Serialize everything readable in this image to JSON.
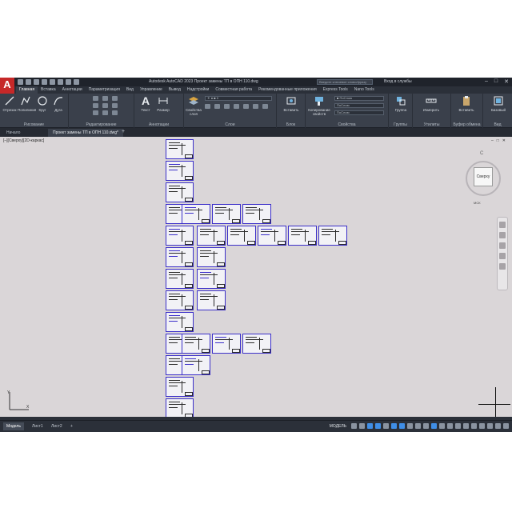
{
  "window": {
    "title": "Autodesk AutoCAD 2023   Проект замены ТП в ОПН 110.dwg",
    "search_placeholder": "Введите ключевое слово/фразу",
    "user": "Вход в службы",
    "controls": [
      "–",
      "□",
      "✕"
    ]
  },
  "ribbon_tabs": [
    "Главная",
    "Вставка",
    "Аннотации",
    "Параметризация",
    "Вид",
    "Управление",
    "Вывод",
    "Надстройки",
    "Совместная работа",
    "Рекомендованные приложения",
    "Express Tools",
    "Nano Tools"
  ],
  "ribbon": {
    "draw": {
      "title": "Рисование",
      "tools": [
        "Отрезок",
        "Полилиния",
        "Круг",
        "Дуга"
      ]
    },
    "modify": {
      "title": "Редактирование"
    },
    "annotation": {
      "title": "Аннотации",
      "tools": [
        "Текст",
        "Размер"
      ]
    },
    "layers": {
      "title": "Слои",
      "tools": [
        "Свойства слоя"
      ]
    },
    "block": {
      "title": "Блок",
      "tools": [
        "Вставить"
      ]
    },
    "properties": {
      "title": "Свойства",
      "tools": [
        "Копирование свойств"
      ],
      "linetype": "ПоСлою",
      "lineweight": "ПоСлою"
    },
    "groups": {
      "title": "Группы",
      "tools": [
        "Группа"
      ]
    },
    "utilities": {
      "title": "Утилиты",
      "tools": [
        "Измерить"
      ]
    },
    "clipboard": {
      "title": "Буфер обмена",
      "tools": [
        "Вставить"
      ]
    },
    "view": {
      "title": "Вид",
      "tools": [
        "Базовый"
      ]
    }
  },
  "file_tabs": {
    "start": "Начало",
    "active": "Проект замены ТП в ОПН 110.dwg*",
    "add": "+"
  },
  "viewport": {
    "label": "[–][Сверху][2D-каркас]",
    "controls": [
      "–",
      "□",
      "✕"
    ],
    "viewcube_face": "Сверху",
    "viewcube_north": "С",
    "wcs": "МСК"
  },
  "statusbar": {
    "layout_tabs": [
      "Модель",
      "Лист1",
      "Лист2",
      "+"
    ],
    "model_label": "МОДЕЛЬ"
  },
  "colors": {
    "accent": "#3b2fc9",
    "ribbon": "#3a404b",
    "canvas": "#dad6d8",
    "logo": "#c62828"
  }
}
